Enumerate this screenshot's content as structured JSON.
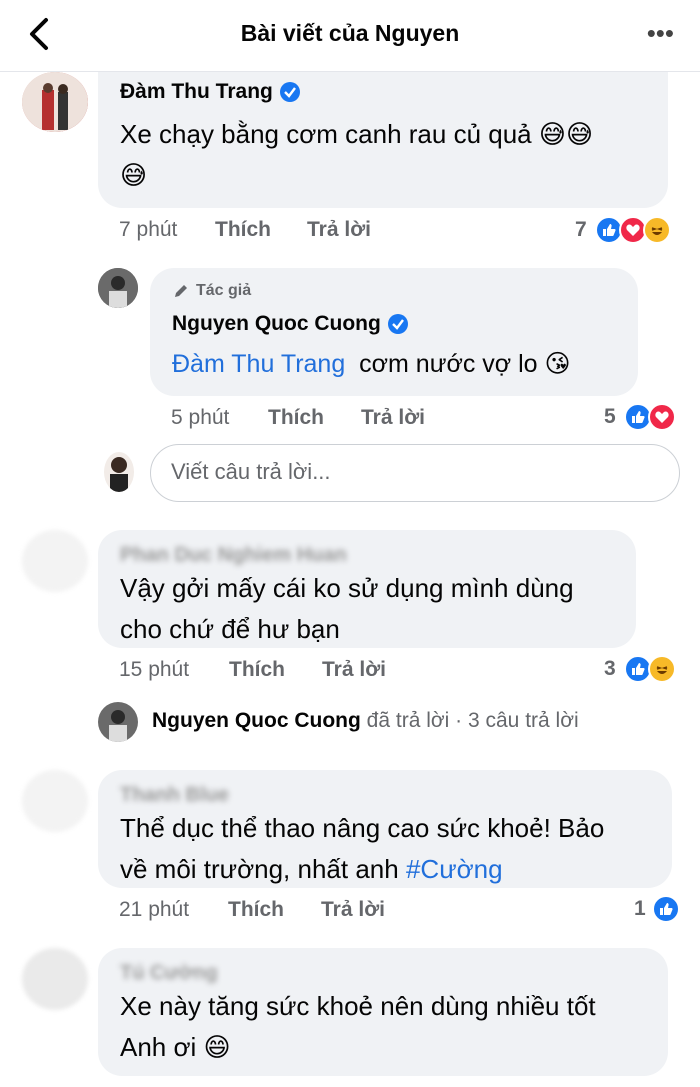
{
  "header": {
    "title": "Bài viết của Nguyen",
    "more": "•••"
  },
  "comments": [
    {
      "author": "Đàm Thu Trang",
      "text": "Xe chạy bằng cơm canh rau củ quả",
      "emoji_after": "😅😅",
      "text2_emoji": "😅",
      "time": "7 phút",
      "like": "Thích",
      "reply": "Trả lời",
      "reaction_count": "7",
      "reactions": [
        "like",
        "love",
        "haha"
      ]
    },
    {
      "badge": "Tác giả",
      "author": "Nguyen Quoc Cuong",
      "mention": "Đàm Thu Trang",
      "text": "cơm nước vợ lo",
      "emoji": "😘",
      "time": "5 phút",
      "like": "Thích",
      "reply": "Trả lời",
      "reaction_count": "5",
      "reactions": [
        "like",
        "love"
      ]
    },
    {
      "author": "Phan Duc Nghiem Huan",
      "text_line1": "Vậy gởi mấy cái ko sử dụng mình dùng",
      "text_line2": "cho chứ để hư bạn",
      "time": "15 phút",
      "like": "Thích",
      "reply": "Trả lời",
      "reaction_count": "3",
      "reactions": [
        "like",
        "haha"
      ]
    },
    {
      "author": "Thanh Blue",
      "text_line1": "Thể dục thể thao nâng cao sức khoẻ! Bảo",
      "text_line2": "về môi trường, nhất anh",
      "hashtag": "#Cường",
      "time": "21 phút",
      "like": "Thích",
      "reply": "Trả lời",
      "reaction_count": "1",
      "reactions": [
        "like"
      ]
    },
    {
      "author": "Tú Cường",
      "text_line1": "Xe này tăng sức khoẻ nên dùng nhiều tốt",
      "text_line2": "Anh ơi",
      "emoji": "😄"
    }
  ],
  "reply_input": {
    "placeholder": "Viết câu trả lời..."
  },
  "reply_summary": {
    "author": "Nguyen Quoc Cuong",
    "text": "đã trả lời",
    "count": "· 3 câu trả lời"
  },
  "colors": {
    "link": "#216fdb",
    "bubble": "#f0f2f5",
    "meta": "#65676b",
    "like": "#1877f2",
    "love": "#f02849",
    "haha": "#f7b928"
  }
}
